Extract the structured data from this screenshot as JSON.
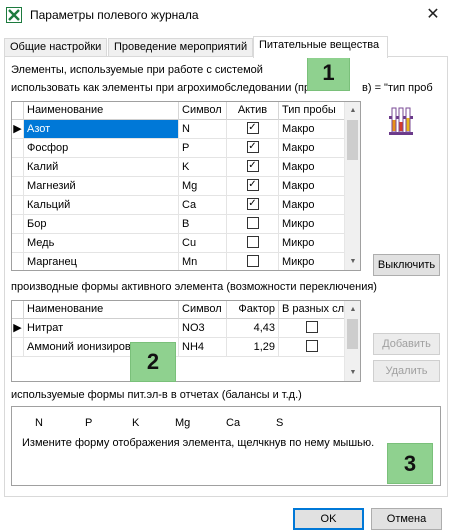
{
  "window": {
    "title": "Параметры полевого журнала",
    "icon": "excel-icon",
    "close_glyph": "✕"
  },
  "tabs": [
    {
      "label": "Общие настройки"
    },
    {
      "label": "Проведение мероприятий"
    },
    {
      "label": "Питательные вещества"
    }
  ],
  "elements_section": {
    "caption": "Элементы, используемые при работе с системой",
    "subcaption": "использовать как элементы при агрохимобследовании (пр",
    "subcaption_tail": "в) = \"тип проб",
    "columns": [
      "Наименование",
      "Символ",
      "Актив",
      "Тип пробы"
    ],
    "rows": [
      {
        "name": "Азот",
        "symbol": "N",
        "active": true,
        "probe": "Макро",
        "selected": true
      },
      {
        "name": "Фосфор",
        "symbol": "P",
        "active": true,
        "probe": "Макро",
        "selected": false
      },
      {
        "name": "Калий",
        "symbol": "K",
        "active": true,
        "probe": "Макро",
        "selected": false
      },
      {
        "name": "Магнезий",
        "symbol": "Mg",
        "active": true,
        "probe": "Макро",
        "selected": false
      },
      {
        "name": "Кальций",
        "symbol": "Ca",
        "active": true,
        "probe": "Макро",
        "selected": false
      },
      {
        "name": "Бор",
        "symbol": "B",
        "active": false,
        "probe": "Микро",
        "selected": false
      },
      {
        "name": "Медь",
        "symbol": "Cu",
        "active": false,
        "probe": "Микро",
        "selected": false
      },
      {
        "name": "Марганец",
        "symbol": "Mn",
        "active": false,
        "probe": "Микро",
        "selected": false
      }
    ],
    "toggle_button": "Выключить",
    "illustration": "test-tubes-icon"
  },
  "forms_section": {
    "caption": "производные формы активного элемента (возможности переключения)",
    "columns": [
      "Наименование",
      "Символ",
      "Фактор",
      "В разных сл"
    ],
    "rows": [
      {
        "name": "Нитрат",
        "symbol": "NO3",
        "factor": "4,43",
        "flag": false
      },
      {
        "name": "Аммоний ионизирова",
        "symbol": "NH4",
        "factor": "1,29",
        "flag": false
      }
    ],
    "add_button": "Добавить",
    "remove_button": "Удалить"
  },
  "report_section": {
    "caption": "используемые формы пит.эл-в в отчетах (балансы и т.д.)",
    "symbols": [
      "N",
      "P",
      "K",
      "Mg",
      "Ca",
      "S"
    ],
    "hint": "Измените форму отображения элемента, щелчкнув по нему мышью."
  },
  "badges": [
    "1",
    "2",
    "3"
  ],
  "footer": {
    "ok": "OK",
    "cancel": "Отмена"
  }
}
